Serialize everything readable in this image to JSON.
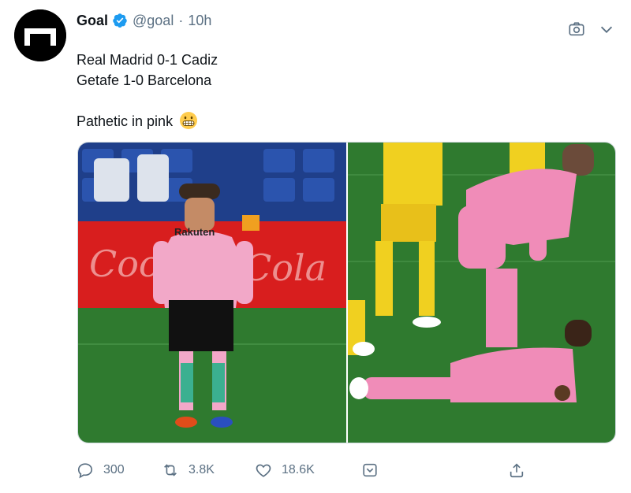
{
  "tweet": {
    "author": {
      "name": "Goal",
      "handle": "@goal",
      "verified": true,
      "verified_icon": "verified-badge-icon"
    },
    "separator": "·",
    "time": "10h",
    "lines": [
      "Real Madrid 0-1 Cadiz",
      "Getafe 1-0 Barcelona",
      "",
      "Pathetic in pink"
    ],
    "emoji": "grimacing-face-emoji",
    "media": {
      "photos": [
        {
          "name": "photo-barcelona-player",
          "shirt_sponsor": "Rakuten"
        },
        {
          "name": "photo-real-madrid-players"
        }
      ]
    },
    "actions": {
      "reply_count": "300",
      "retweet_count": "3.8K",
      "like_count": "18.6K"
    }
  },
  "colors": {
    "text": "#0f1419",
    "secondary": "#5b7083",
    "verified": "#1d9bf0",
    "avatar_bg": "#000000"
  }
}
